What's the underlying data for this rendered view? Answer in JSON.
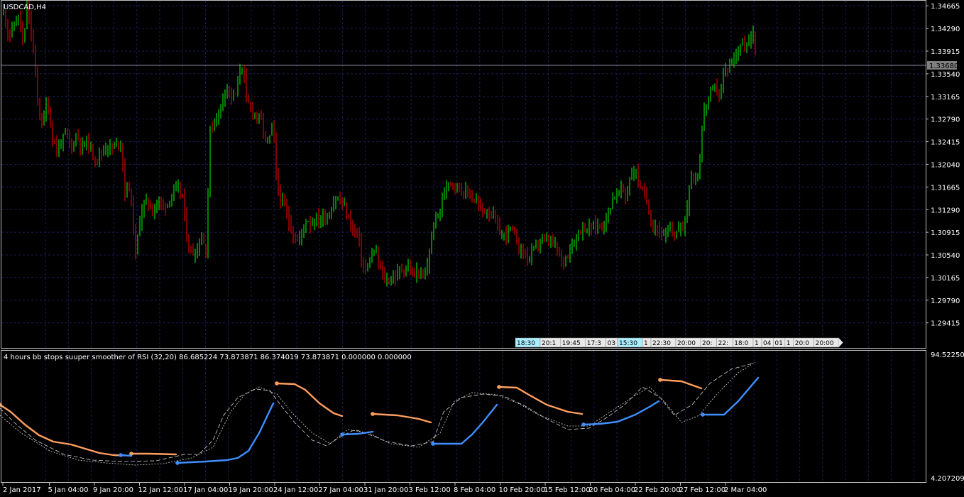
{
  "chart_data": [
    {
      "type": "candlestick",
      "title": "USDCAD,H4",
      "symbol": "USDCAD",
      "timeframe": "H4",
      "ylim": [
        1.29,
        1.3475
      ],
      "y_ticks": [
        "1.34665",
        "1.34290",
        "1.33915",
        "1.33540",
        "1.33165",
        "1.32790",
        "1.32415",
        "1.32040",
        "1.31665",
        "1.31290",
        "1.30915",
        "1.30540",
        "1.30165",
        "1.29790",
        "1.29415"
      ],
      "current_price": "1.33680",
      "bull_color": "#00ff00",
      "bear_color": "#ff0000",
      "series": [
        {
          "name": "USDCAD",
          "close_path": [
            [
              0,
              1.343
            ],
            [
              6,
              1.346
            ],
            [
              12,
              1.3415
            ],
            [
              20,
              1.3435
            ],
            [
              27,
              1.345
            ],
            [
              33,
              1.3395
            ],
            [
              38,
              1.347
            ],
            [
              44,
              1.342
            ],
            [
              49,
              1.337
            ],
            [
              54,
              1.3295
            ],
            [
              60,
              1.327
            ],
            [
              66,
              1.331
            ],
            [
              73,
              1.3255
            ],
            [
              80,
              1.3225
            ],
            [
              87,
              1.3245
            ],
            [
              94,
              1.3255
            ],
            [
              100,
              1.323
            ],
            [
              108,
              1.3255
            ],
            [
              115,
              1.323
            ],
            [
              122,
              1.3245
            ],
            [
              130,
              1.322
            ],
            [
              137,
              1.3215
            ],
            [
              144,
              1.3225
            ],
            [
              151,
              1.3235
            ],
            [
              158,
              1.323
            ],
            [
              165,
              1.324
            ],
            [
              171,
              1.324
            ],
            [
              176,
              1.3155
            ],
            [
              181,
              1.3175
            ],
            [
              186,
              1.313
            ],
            [
              191,
              1.3055
            ],
            [
              196,
              1.3105
            ],
            [
              201,
              1.3135
            ],
            [
              208,
              1.3145
            ],
            [
              215,
              1.3125
            ],
            [
              222,
              1.3145
            ],
            [
              229,
              1.3135
            ],
            [
              236,
              1.314
            ],
            [
              243,
              1.3155
            ],
            [
              250,
              1.3165
            ],
            [
              257,
              1.315
            ],
            [
              263,
              1.3085
            ],
            [
              268,
              1.306
            ],
            [
              273,
              1.3055
            ],
            [
              278,
              1.3065
            ],
            [
              284,
              1.3085
            ],
            [
              290,
              1.306
            ],
            [
              296,
              1.326
            ],
            [
              302,
              1.3275
            ],
            [
              308,
              1.329
            ],
            [
              314,
              1.3315
            ],
            [
              320,
              1.3335
            ],
            [
              326,
              1.3315
            ],
            [
              332,
              1.332
            ],
            [
              338,
              1.336
            ],
            [
              342,
              1.337
            ],
            [
              347,
              1.331
            ],
            [
              352,
              1.33
            ],
            [
              357,
              1.329
            ],
            [
              362,
              1.3285
            ],
            [
              368,
              1.3275
            ],
            [
              374,
              1.3245
            ],
            [
              379,
              1.3245
            ],
            [
              385,
              1.327
            ],
            [
              390,
              1.3165
            ],
            [
              396,
              1.3145
            ],
            [
              402,
              1.313
            ],
            [
              408,
              1.3105
            ],
            [
              414,
              1.3085
            ],
            [
              420,
              1.3075
            ],
            [
              426,
              1.3095
            ],
            [
              432,
              1.3115
            ],
            [
              438,
              1.3105
            ],
            [
              444,
              1.3115
            ],
            [
              450,
              1.311
            ],
            [
              456,
              1.312
            ],
            [
              462,
              1.3115
            ],
            [
              468,
              1.3135
            ],
            [
              474,
              1.315
            ],
            [
              480,
              1.314
            ],
            [
              486,
              1.313
            ],
            [
              492,
              1.311
            ],
            [
              498,
              1.3095
            ],
            [
              504,
              1.309
            ],
            [
              510,
              1.304
            ],
            [
              516,
              1.3025
            ],
            [
              522,
              1.305
            ],
            [
              528,
              1.306
            ],
            [
              534,
              1.304
            ],
            [
              540,
              1.3015
            ],
            [
              546,
              1.301
            ],
            [
              552,
              1.3015
            ],
            [
              558,
              1.302
            ],
            [
              564,
              1.303
            ],
            [
              570,
              1.303
            ],
            [
              576,
              1.3035
            ],
            [
              582,
              1.3015
            ],
            [
              588,
              1.303
            ],
            [
              594,
              1.3015
            ],
            [
              600,
              1.302
            ],
            [
              606,
              1.307
            ],
            [
              612,
              1.311
            ],
            [
              618,
              1.3125
            ],
            [
              624,
              1.3145
            ],
            [
              630,
              1.318
            ],
            [
              636,
              1.3175
            ],
            [
              642,
              1.317
            ],
            [
              648,
              1.3165
            ],
            [
              654,
              1.3155
            ],
            [
              660,
              1.316
            ],
            [
              666,
              1.3145
            ],
            [
              672,
              1.314
            ],
            [
              678,
              1.313
            ],
            [
              684,
              1.3125
            ],
            [
              690,
              1.3125
            ],
            [
              696,
              1.3115
            ],
            [
              702,
              1.3095
            ],
            [
              708,
              1.3085
            ],
            [
              714,
              1.309
            ],
            [
              720,
              1.31
            ],
            [
              726,
              1.308
            ],
            [
              732,
              1.3065
            ],
            [
              738,
              1.306
            ],
            [
              744,
              1.3045
            ],
            [
              750,
              1.306
            ],
            [
              756,
              1.307
            ],
            [
              762,
              1.308
            ],
            [
              768,
              1.3075
            ],
            [
              774,
              1.308
            ],
            [
              780,
              1.307
            ],
            [
              786,
              1.306
            ],
            [
              792,
              1.304
            ],
            [
              798,
              1.3055
            ],
            [
              804,
              1.3065
            ],
            [
              810,
              1.308
            ],
            [
              816,
              1.3095
            ],
            [
              822,
              1.31
            ],
            [
              828,
              1.3095
            ],
            [
              834,
              1.31
            ],
            [
              840,
              1.3105
            ],
            [
              846,
              1.31
            ],
            [
              852,
              1.311
            ],
            [
              858,
              1.313
            ],
            [
              864,
              1.315
            ],
            [
              870,
              1.3155
            ],
            [
              876,
              1.3165
            ],
            [
              882,
              1.315
            ],
            [
              888,
              1.3185
            ],
            [
              894,
              1.3195
            ],
            [
              900,
              1.3175
            ],
            [
              906,
              1.3155
            ],
            [
              912,
              1.314
            ],
            [
              918,
              1.3105
            ],
            [
              924,
              1.31
            ],
            [
              930,
              1.3095
            ],
            [
              936,
              1.308
            ],
            [
              942,
              1.3095
            ],
            [
              948,
              1.309
            ],
            [
              954,
              1.3095
            ],
            [
              960,
              1.31
            ],
            [
              966,
              1.311
            ],
            [
              972,
              1.3185
            ],
            [
              978,
              1.318
            ],
            [
              984,
              1.3185
            ],
            [
              990,
              1.328
            ],
            [
              996,
              1.331
            ],
            [
              1002,
              1.3325
            ],
            [
              1008,
              1.333
            ],
            [
              1014,
              1.332
            ],
            [
              1020,
              1.3355
            ],
            [
              1026,
              1.3365
            ],
            [
              1032,
              1.3375
            ],
            [
              1038,
              1.3395
            ],
            [
              1044,
              1.3405
            ],
            [
              1050,
              1.3395
            ],
            [
              1056,
              1.3405
            ],
            [
              1062,
              1.3425
            ],
            [
              1067,
              1.3368
            ]
          ]
        }
      ]
    },
    {
      "type": "line",
      "title": "4 hours bb stops suuper smoother of RSI (32,20) 86.685224 73.873871 86.374019 73.873871 0.000000 0.000000",
      "ylim": [
        4.207209,
        94.522502
      ],
      "y_ticks": [
        "94.522502",
        "4.207209"
      ],
      "series": [
        {
          "name": "RSI smoother (orange segments)",
          "color": "#ff9f5f",
          "values": [
            [
              0,
              30
            ],
            [
              15,
              40
            ],
            [
              35,
              58
            ],
            [
              55,
              73
            ],
            [
              75,
              82
            ],
            [
              100,
              86
            ],
            [
              120,
              92
            ],
            [
              140,
              98
            ],
            [
              160,
              101
            ],
            [
              175,
              101.5
            ]
          ]
        },
        {
          "name": "RSI smoother (orange segments)",
          "color": "#ff9f5f",
          "values": [
            [
              185,
              99
            ],
            [
              210,
              99
            ],
            [
              248,
              100
            ]
          ]
        },
        {
          "name": "RSI smoother (orange segments)",
          "color": "#ff9f5f",
          "values": [
            [
              390,
              0
            ],
            [
              415,
              1
            ],
            [
              430,
              9
            ],
            [
              450,
              28
            ],
            [
              470,
              42
            ],
            [
              482,
              46
            ]
          ]
        },
        {
          "name": "RSI smoother (orange segments)",
          "color": "#ff9f5f",
          "values": [
            [
              525,
              43
            ],
            [
              560,
              45
            ],
            [
              590,
              50
            ],
            [
              607,
              55
            ]
          ]
        },
        {
          "name": "RSI smoother (orange segments)",
          "color": "#ff9f5f",
          "values": [
            [
              703,
              5
            ],
            [
              728,
              6
            ],
            [
              745,
              16
            ],
            [
              770,
              30
            ],
            [
              800,
              40
            ],
            [
              820,
              43
            ]
          ]
        },
        {
          "name": "RSI smoother (orange segments)",
          "color": "#ff9f5f",
          "values": [
            [
              930,
              -5
            ],
            [
              960,
              -3
            ],
            [
              988,
              7
            ]
          ]
        },
        {
          "name": "RSI smoother (blue segments)",
          "color": "#3f8fff",
          "values": [
            [
              170,
              101
            ],
            [
              185,
              102
            ]
          ]
        },
        {
          "name": "RSI smoother (blue segments)",
          "color": "#3f8fff",
          "values": [
            [
              250,
              112
            ],
            [
              290,
              110
            ],
            [
              320,
              108
            ],
            [
              335,
              105
            ],
            [
              350,
              95
            ],
            [
              365,
              70
            ],
            [
              385,
              28
            ]
          ]
        },
        {
          "name": "RSI smoother (blue segments)",
          "color": "#3f8fff",
          "values": [
            [
              482,
              72
            ],
            [
              505,
              71
            ],
            [
              525,
              68
            ]
          ]
        },
        {
          "name": "RSI smoother (blue segments)",
          "color": "#3f8fff",
          "values": [
            [
              610,
              85
            ],
            [
              650,
              85
            ],
            [
              665,
              72
            ],
            [
              680,
              55
            ],
            [
              700,
              30
            ]
          ]
        },
        {
          "name": "RSI smoother (blue segments)",
          "color": "#3f8fff",
          "values": [
            [
              822,
              58
            ],
            [
              845,
              57
            ],
            [
              870,
              54
            ],
            [
              895,
              44
            ],
            [
              915,
              33
            ],
            [
              928,
              25
            ]
          ]
        },
        {
          "name": "RSI smoother (blue segments)",
          "color": "#3f8fff",
          "values": [
            [
              990,
              44
            ],
            [
              1020,
              44
            ],
            [
              1040,
              25
            ],
            [
              1068,
              -8
            ]
          ]
        }
      ]
    }
  ],
  "x_axis_labels": [
    "2 Jan 2017",
    "5 Jan 04:00",
    "9 Jan 20:00",
    "12 Jan 12:00",
    "17 Jan 04:00",
    "19 Jan 20:00",
    "24 Jan 12:00",
    "27 Jan 04:00",
    "31 Jan 20:00",
    "3 Feb 12:00",
    "8 Feb 04:00",
    "10 Feb 20:00",
    "15 Feb 12:00",
    "20 Feb 04:00",
    "22 Feb 20:00",
    "27 Feb 12:00",
    "2 Mar 04:00"
  ],
  "time_scroller_labels": [
    "18:30",
    "20:1",
    "19:45",
    "17:3",
    "03",
    "15:30",
    "1",
    "22:30",
    "20:00",
    "20:",
    "22:",
    "18:0",
    "1",
    "04",
    "01",
    "1",
    "20:0",
    "20:00"
  ],
  "colors": {
    "background": "#000000",
    "grid": "#1c1c5a",
    "axis_text": "#ffffff",
    "price_line": "#8a8aa0",
    "price_label_bg": "#7f7f7f",
    "scroller_bg": "#e8e8e8",
    "scroller_highlight": "#aaeeff"
  }
}
